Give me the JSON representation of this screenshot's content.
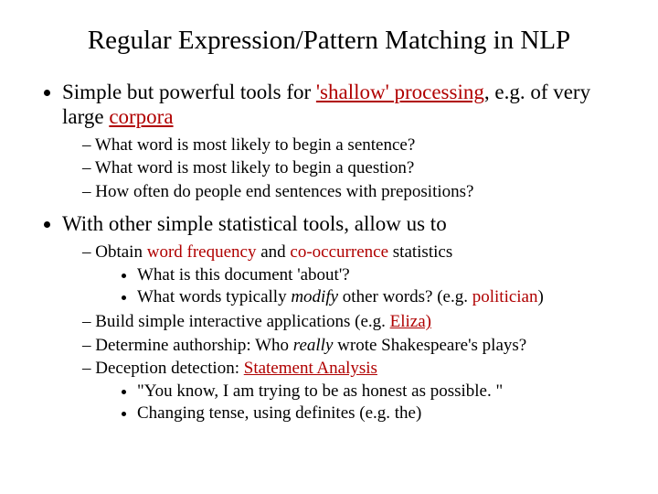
{
  "title": "Regular Expression/Pattern Matching in NLP",
  "b1": {
    "lead": "Simple but powerful tools for ",
    "shallow": "'shallow' processing",
    "mid": ", e.g. of very large ",
    "corpora": "corpora",
    "sub": [
      "What word is most likely to begin a sentence?",
      "What word is most likely to begin a question?",
      "How often do people end sentences with prepositions?"
    ]
  },
  "b2": {
    "text": "With other simple statistical tools, allow us to",
    "s1": {
      "pre": "Obtain ",
      "wf": "word frequency",
      "mid": " and ",
      "co": "co-occurrence",
      "post": " statistics",
      "sub": {
        "a": "What is this document 'about'?",
        "b_pre": "What words typically ",
        "b_mod": "modify",
        "b_mid": " other words?  (e.g. ",
        "b_pol": "politician",
        "b_post": ")"
      }
    },
    "s2": {
      "pre": "Build simple interactive applications (e.g. ",
      "eliza": "Eliza)"
    },
    "s3": {
      "pre": "Determine authorship:  Who ",
      "really": "really",
      "post": " wrote Shakespeare's plays?"
    },
    "s4": {
      "pre": "Deception detection:  ",
      "sa": "Statement Analysis",
      "sub": {
        "a": "\"You know, I am trying to be as honest as possible. \"",
        "b": "Changing tense, using definites (e.g. the)"
      }
    }
  }
}
